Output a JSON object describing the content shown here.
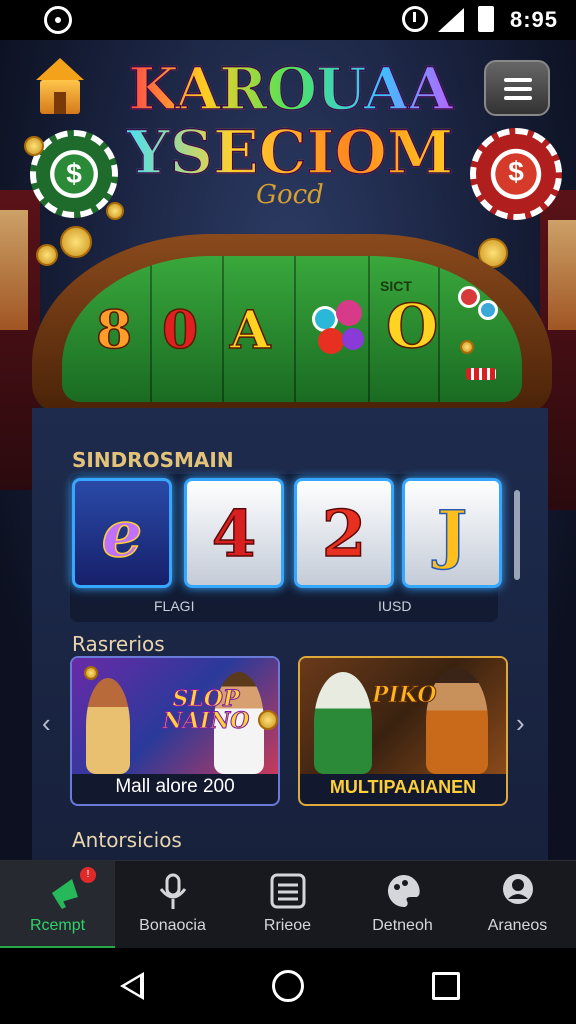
{
  "status_bar": {
    "time": "8:95",
    "icons": [
      "app-circle-icon",
      "alarm-icon",
      "signal-icon",
      "battery-icon"
    ]
  },
  "header": {
    "logo_line1": "KAROUAA",
    "logo_line2": "YSECIOM",
    "logo_sub": "Gocd",
    "icons": [
      "home-icon",
      "menu-icon"
    ]
  },
  "slot_table": {
    "symbols": [
      "8",
      "0",
      "A",
      "O"
    ],
    "small_label": "SICT"
  },
  "sections": {
    "reels_title": "SINDROSMAIN",
    "games_title": "Rasrerios",
    "footer_title": "Antorsicios"
  },
  "reels": [
    {
      "symbol": "e"
    },
    {
      "symbol": "4"
    },
    {
      "symbol": "2"
    },
    {
      "symbol": "J"
    }
  ],
  "reel_captions": [
    "FLAGI",
    "IUSD"
  ],
  "games": [
    {
      "logo": "SLOP NAINO",
      "label": "Mall alore 200"
    },
    {
      "logo": "PIKO",
      "label": "MULTIPAAIANEN"
    }
  ],
  "bottom_nav": [
    {
      "label": "Rcempt",
      "icon": "megaphone-icon",
      "active": true
    },
    {
      "label": "Bonaocia",
      "icon": "microphone-icon",
      "active": false
    },
    {
      "label": "Rrieoe",
      "icon": "list-icon",
      "active": false
    },
    {
      "label": "Detneoh",
      "icon": "palette-icon",
      "active": false
    },
    {
      "label": "Araneos",
      "icon": "profile-icon",
      "active": false
    }
  ],
  "colors": {
    "accent_green": "#2fd26a",
    "reel_border": "#37a6ff",
    "gold": "#e3c27a"
  }
}
